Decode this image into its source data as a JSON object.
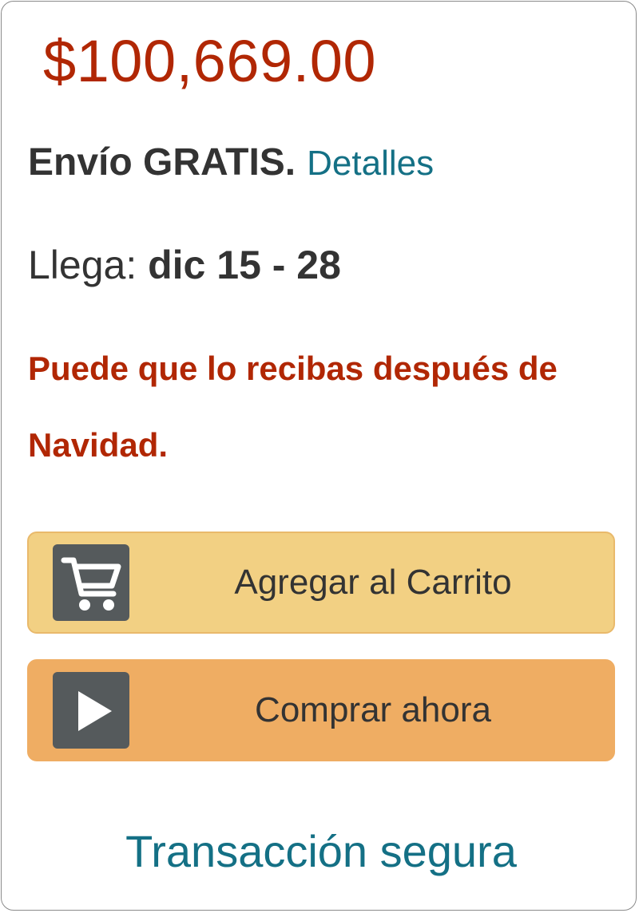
{
  "price": "$100,669.00",
  "shipping": {
    "free_text": "Envío GRATIS.",
    "details_link": "Detalles"
  },
  "arrival": {
    "label": "Llega: ",
    "date_range": "dic 15 - 28"
  },
  "warning": "Puede que lo recibas después de Navidad.",
  "buttons": {
    "add_to_cart": {
      "label": "Agregar al Carrito",
      "icon": "cart-icon",
      "color": "#f2d083"
    },
    "buy_now": {
      "label": "Comprar ahora",
      "icon": "play-icon",
      "color": "#efad63"
    }
  },
  "secure_transaction": "Transacción segura",
  "colors": {
    "price": "#b12704",
    "link": "#147085",
    "warning": "#b12704",
    "icon_box": "#555a5c"
  }
}
